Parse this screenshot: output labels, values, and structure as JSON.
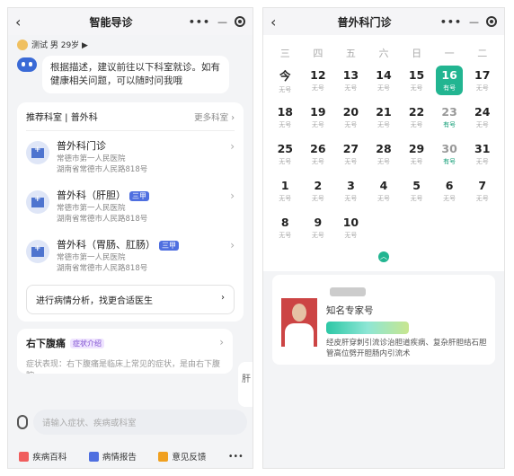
{
  "left": {
    "header": {
      "title": "智能导诊",
      "more": "•••",
      "minimize": "—"
    },
    "user": {
      "label": "测试 男 29岁 ▶"
    },
    "bot_message": "根据描述，建议前往以下科室就诊。如有健康相关问题，可以随时问我哦",
    "recommend": {
      "title": "推荐科室 | 普外科",
      "more": "更多科室 ›",
      "departments": [
        {
          "name": "普外科门诊",
          "badge": "三甲",
          "hospital": "常德市第一人民医院",
          "address": "湖南省常德市人民路818号"
        },
        {
          "name": "普外科（肝胆）",
          "badge": "三甲",
          "hospital": "常德市第一人民医院",
          "address": "湖南省常德市人民路818号"
        },
        {
          "name": "普外科（胃肠、肛肠）",
          "badge": "三甲",
          "hospital": "常德市第一人民医院",
          "address": "湖南省常德市人民路818号"
        }
      ],
      "analyze_label": "进行病情分析，找更合适医生"
    },
    "symptom": {
      "title": "右下腹痛",
      "tag": "症状介绍",
      "text": "症状表现：右下腹痛是临床上常见的症状，是由右下腹腔"
    },
    "side_card": "肝",
    "input": {
      "placeholder": "请输入症状、疾病或科室"
    },
    "bottom": [
      {
        "label": "疾病百科",
        "icon": "book-icon"
      },
      {
        "label": "病情报告",
        "icon": "report-icon"
      },
      {
        "label": "意见反馈",
        "icon": "feedback-icon"
      }
    ],
    "bottom_more": "•••"
  },
  "right": {
    "header": {
      "title": "普外科门诊",
      "more": "•••",
      "minimize": "—"
    },
    "weekdays": [
      "三",
      "四",
      "五",
      "六",
      "日",
      "一",
      "二"
    ],
    "days": [
      {
        "num": "今",
        "status": "无号"
      },
      {
        "num": "12",
        "status": "无号"
      },
      {
        "num": "13",
        "status": "无号"
      },
      {
        "num": "14",
        "status": "无号"
      },
      {
        "num": "15",
        "status": "无号"
      },
      {
        "num": "16",
        "status": "有号",
        "selected": true
      },
      {
        "num": "17",
        "status": "无号"
      },
      {
        "num": "18",
        "status": "无号"
      },
      {
        "num": "19",
        "status": "无号"
      },
      {
        "num": "20",
        "status": "无号"
      },
      {
        "num": "21",
        "status": "无号"
      },
      {
        "num": "22",
        "status": "无号"
      },
      {
        "num": "23",
        "status": "有号",
        "available": true
      },
      {
        "num": "24",
        "status": "无号"
      },
      {
        "num": "25",
        "status": "无号"
      },
      {
        "num": "26",
        "status": "无号"
      },
      {
        "num": "27",
        "status": "无号"
      },
      {
        "num": "28",
        "status": "无号"
      },
      {
        "num": "29",
        "status": "无号"
      },
      {
        "num": "30",
        "status": "有号",
        "available": true
      },
      {
        "num": "31",
        "status": "无号"
      },
      {
        "num": "1",
        "status": "无号"
      },
      {
        "num": "2",
        "status": "无号"
      },
      {
        "num": "3",
        "status": "无号"
      },
      {
        "num": "4",
        "status": "无号"
      },
      {
        "num": "5",
        "status": "无号"
      },
      {
        "num": "6",
        "status": "无号"
      },
      {
        "num": "7",
        "status": "无号"
      },
      {
        "num": "8",
        "status": "无号"
      },
      {
        "num": "9",
        "status": "无号"
      },
      {
        "num": "10",
        "status": "无号"
      }
    ],
    "doctor": {
      "title": "知名专家号",
      "desc": "经皮肝穿刺引流诊治胆道疾病、复杂肝胆结石胆管高位劈开胆肠内引流术"
    },
    "colors": {
      "accent": "#22b591",
      "badge": "#4f6fe0"
    }
  }
}
